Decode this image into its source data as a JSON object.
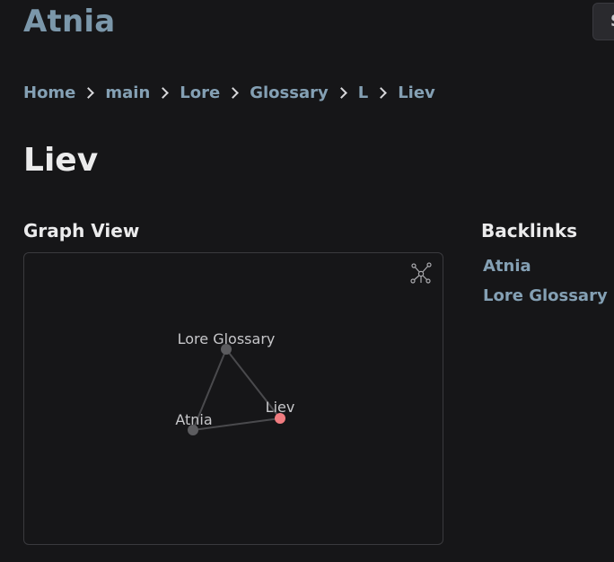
{
  "site": {
    "title": "Atnia",
    "search_label": "Search"
  },
  "breadcrumb": [
    "Home",
    "main",
    "Lore",
    "Glossary",
    "L",
    "Liev"
  ],
  "page": {
    "title": "Liev"
  },
  "graph": {
    "heading": "Graph View",
    "nodes": [
      {
        "id": "lore-glossary",
        "label": "Lore Glossary",
        "current": false
      },
      {
        "id": "atnia",
        "label": "Atnia",
        "current": false
      },
      {
        "id": "liev",
        "label": "Liev",
        "current": true
      }
    ],
    "edges": [
      [
        "lore-glossary",
        "atnia"
      ],
      [
        "lore-glossary",
        "liev"
      ],
      [
        "atnia",
        "liev"
      ]
    ],
    "colors": {
      "node": "#5c5c5f",
      "current": "#f07c80",
      "edge": "#4a4a4d"
    }
  },
  "backlinks": {
    "heading": "Backlinks",
    "items": [
      "Atnia",
      "Lore Glossary"
    ]
  }
}
